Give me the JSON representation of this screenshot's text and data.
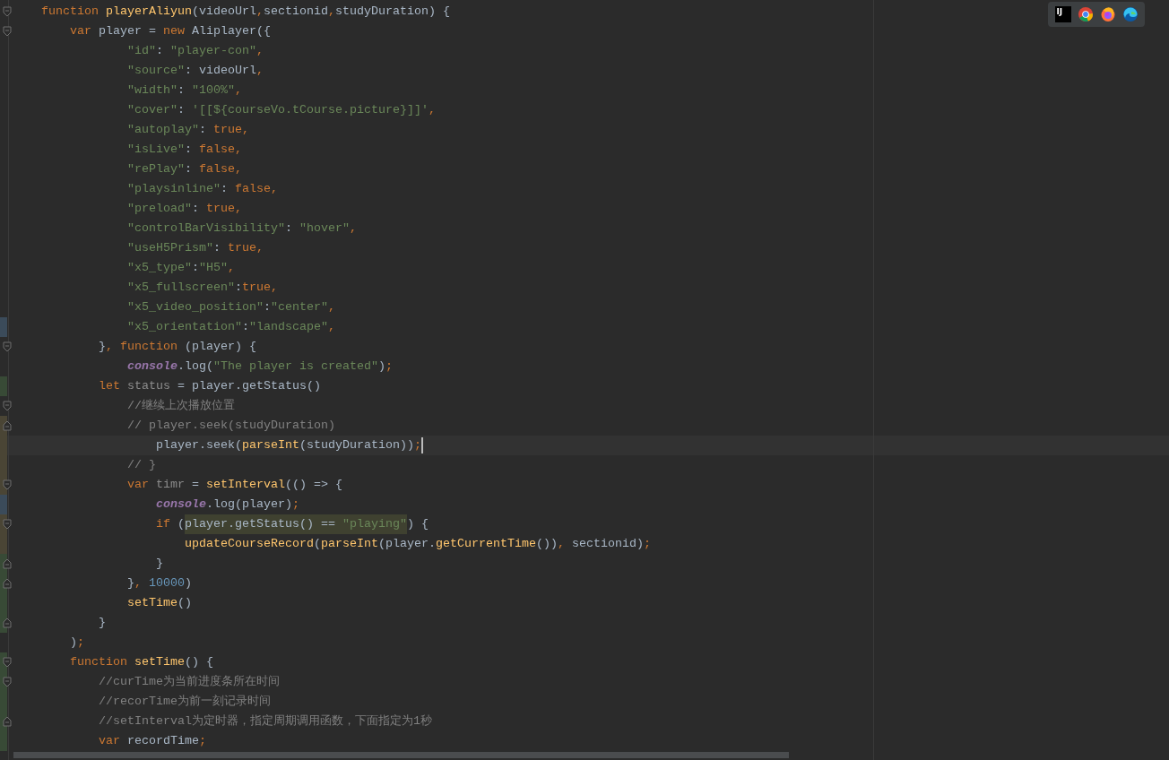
{
  "toolbar": {
    "items": [
      {
        "kind": "ij",
        "label": "IJ"
      },
      {
        "kind": "chrome"
      },
      {
        "kind": "firefox"
      },
      {
        "kind": "edge"
      }
    ]
  },
  "editor": {
    "lines": [
      {
        "caret": false,
        "fold_start": true,
        "tokens": [
          {
            "kind": "kw",
            "text": "function "
          },
          {
            "kind": "fn",
            "text": "playerAliyun"
          },
          {
            "kind": "plain",
            "text": "(videoUrl"
          },
          {
            "kind": "punct",
            "text": ","
          },
          {
            "kind": "plain",
            "text": "sectionid"
          },
          {
            "kind": "punct",
            "text": ","
          },
          {
            "kind": "plain",
            "text": "studyDuration) {"
          }
        ]
      },
      {
        "caret": false,
        "fold_start": true,
        "tokens": [
          {
            "kind": "kw",
            "text": "    var "
          },
          {
            "kind": "plain",
            "text": "player = "
          },
          {
            "kind": "kw",
            "text": "new "
          },
          {
            "kind": "plain",
            "text": "Aliplayer({"
          }
        ]
      },
      {
        "caret": false,
        "tokens": [
          {
            "kind": "str",
            "text": "            \"id\""
          },
          {
            "kind": "plain",
            "text": ": "
          },
          {
            "kind": "str",
            "text": "\"player-con\""
          },
          {
            "kind": "punct",
            "text": ","
          }
        ]
      },
      {
        "caret": false,
        "tokens": [
          {
            "kind": "str",
            "text": "            \"source\""
          },
          {
            "kind": "plain",
            "text": ": videoUrl"
          },
          {
            "kind": "punct",
            "text": ","
          }
        ]
      },
      {
        "caret": false,
        "tokens": [
          {
            "kind": "str",
            "text": "            \"width\""
          },
          {
            "kind": "plain",
            "text": ": "
          },
          {
            "kind": "str",
            "text": "\"100%\""
          },
          {
            "kind": "punct",
            "text": ","
          }
        ]
      },
      {
        "caret": false,
        "tokens": [
          {
            "kind": "str",
            "text": "            \"cover\""
          },
          {
            "kind": "plain",
            "text": ": "
          },
          {
            "kind": "str",
            "text": "'[[${courseVo.tCourse.picture}]]'"
          },
          {
            "kind": "punct",
            "text": ","
          }
        ]
      },
      {
        "caret": false,
        "tokens": [
          {
            "kind": "str",
            "text": "            \"autoplay\""
          },
          {
            "kind": "plain",
            "text": ": "
          },
          {
            "kind": "kw",
            "text": "true,"
          }
        ]
      },
      {
        "caret": false,
        "tokens": [
          {
            "kind": "str",
            "text": "            \"isLive\""
          },
          {
            "kind": "plain",
            "text": ": "
          },
          {
            "kind": "kw",
            "text": "false,"
          }
        ]
      },
      {
        "caret": false,
        "tokens": [
          {
            "kind": "str",
            "text": "            \"rePlay\""
          },
          {
            "kind": "plain",
            "text": ": "
          },
          {
            "kind": "kw",
            "text": "false,"
          }
        ]
      },
      {
        "caret": false,
        "tokens": [
          {
            "kind": "str",
            "text": "            \"playsinline\""
          },
          {
            "kind": "plain",
            "text": ": "
          },
          {
            "kind": "kw",
            "text": "false,"
          }
        ]
      },
      {
        "caret": false,
        "tokens": [
          {
            "kind": "str",
            "text": "            \"preload\""
          },
          {
            "kind": "plain",
            "text": ": "
          },
          {
            "kind": "kw",
            "text": "true,"
          }
        ]
      },
      {
        "caret": false,
        "tokens": [
          {
            "kind": "str",
            "text": "            \"controlBarVisibility\""
          },
          {
            "kind": "plain",
            "text": ": "
          },
          {
            "kind": "str",
            "text": "\"hover\""
          },
          {
            "kind": "punct",
            "text": ","
          }
        ]
      },
      {
        "caret": false,
        "tokens": [
          {
            "kind": "str",
            "text": "            \"useH5Prism\""
          },
          {
            "kind": "plain",
            "text": ": "
          },
          {
            "kind": "kw",
            "text": "true,"
          }
        ]
      },
      {
        "caret": false,
        "tokens": [
          {
            "kind": "str",
            "text": "            \"x5_type\""
          },
          {
            "kind": "plain",
            "text": ":"
          },
          {
            "kind": "str",
            "text": "\"H5\""
          },
          {
            "kind": "punct",
            "text": ","
          }
        ]
      },
      {
        "caret": false,
        "tokens": [
          {
            "kind": "str",
            "text": "            \"x5_fullscreen\""
          },
          {
            "kind": "plain",
            "text": ":"
          },
          {
            "kind": "kw",
            "text": "true,"
          }
        ]
      },
      {
        "caret": false,
        "tokens": [
          {
            "kind": "str",
            "text": "            \"x5_video_position\""
          },
          {
            "kind": "plain",
            "text": ":"
          },
          {
            "kind": "str",
            "text": "\"center\""
          },
          {
            "kind": "punct",
            "text": ","
          }
        ]
      },
      {
        "caret": false,
        "color": "#3b4b5a",
        "tokens": [
          {
            "kind": "str",
            "text": "            \"x5_orientation\""
          },
          {
            "kind": "plain",
            "text": ":"
          },
          {
            "kind": "str",
            "text": "\"landscape\""
          },
          {
            "kind": "punct",
            "text": ","
          }
        ]
      },
      {
        "caret": false,
        "fold_start": true,
        "tokens": [
          {
            "kind": "plain",
            "text": "        }"
          },
          {
            "kind": "punct",
            "text": ", "
          },
          {
            "kind": "kw",
            "text": "function "
          },
          {
            "kind": "plain",
            "text": "(player) {"
          }
        ]
      },
      {
        "caret": false,
        "tokens": [
          {
            "kind": "global",
            "text": "            console"
          },
          {
            "kind": "plain",
            "text": ".log("
          },
          {
            "kind": "str",
            "text": "\"The player is created\""
          },
          {
            "kind": "plain",
            "text": ")"
          },
          {
            "kind": "punct",
            "text": ";"
          }
        ]
      },
      {
        "caret": false,
        "color": "#384a36",
        "tokens": [
          {
            "kind": "kw",
            "text": "        let "
          },
          {
            "kind": "unused",
            "text": "status"
          },
          {
            "kind": "plain",
            "text": " = player.getStatus()"
          }
        ]
      },
      {
        "caret": false,
        "fold_start": true,
        "tokens": [
          {
            "kind": "comment",
            "text": "            //继续上次播放位置"
          }
        ]
      },
      {
        "caret": false,
        "fold_end": true,
        "color": "#4a4535",
        "tokens": [
          {
            "kind": "comment",
            "text": "            // player.seek(studyDuration)"
          }
        ]
      },
      {
        "caret": true,
        "color": "#4a4535",
        "tokens": [
          {
            "kind": "plain",
            "text": "                player.seek("
          },
          {
            "kind": "fn",
            "text": "parseInt"
          },
          {
            "kind": "plain",
            "text": "(studyDuration))"
          },
          {
            "kind": "punct",
            "text": ";"
          }
        ]
      },
      {
        "caret": false,
        "color": "#4a4535",
        "tokens": [
          {
            "kind": "comment",
            "text": "            // }"
          }
        ]
      },
      {
        "caret": false,
        "fold_start": true,
        "color": "#4a4535",
        "tokens": [
          {
            "kind": "kw",
            "text": "            var "
          },
          {
            "kind": "unused",
            "text": "timr"
          },
          {
            "kind": "plain",
            "text": " = "
          },
          {
            "kind": "fn",
            "text": "setInterval"
          },
          {
            "kind": "plain",
            "text": "(() => {"
          }
        ]
      },
      {
        "caret": false,
        "color": "#3b4b5a",
        "tokens": [
          {
            "kind": "global",
            "text": "                console"
          },
          {
            "kind": "plain",
            "text": ".log(player)"
          },
          {
            "kind": "punct",
            "text": ";"
          }
        ]
      },
      {
        "caret": false,
        "fold_start": true,
        "color": "#4a4535",
        "tokens": [
          {
            "kind": "kw",
            "text": "                if "
          },
          {
            "kind": "plain",
            "text": "("
          },
          {
            "kind": "mark",
            "text": "player.getStatus() == "
          },
          {
            "kind": "markstr",
            "text": "\"playing\""
          },
          {
            "kind": "plain",
            "text": ") {"
          }
        ]
      },
      {
        "caret": false,
        "color": "#4a4535",
        "tokens": [
          {
            "kind": "fn",
            "text": "                    updateCourseRecord"
          },
          {
            "kind": "plain",
            "text": "("
          },
          {
            "kind": "fn",
            "text": "parseInt"
          },
          {
            "kind": "plain",
            "text": "(player."
          },
          {
            "kind": "fn",
            "text": "getCurrentTime"
          },
          {
            "kind": "plain",
            "text": "())"
          },
          {
            "kind": "punct",
            "text": ", "
          },
          {
            "kind": "plain",
            "text": "sectionid)"
          },
          {
            "kind": "punct",
            "text": ";"
          }
        ]
      },
      {
        "caret": false,
        "fold_end": true,
        "color": "#384a36",
        "tokens": [
          {
            "kind": "plain",
            "text": "                }"
          }
        ]
      },
      {
        "caret": false,
        "fold_end": true,
        "color": "#384a36",
        "tokens": [
          {
            "kind": "plain",
            "text": "            }"
          },
          {
            "kind": "punct",
            "text": ", "
          },
          {
            "kind": "num",
            "text": "10000"
          },
          {
            "kind": "plain",
            "text": ")"
          }
        ]
      },
      {
        "caret": false,
        "color": "#384a36",
        "tokens": [
          {
            "kind": "fn",
            "text": "            setTime"
          },
          {
            "kind": "plain",
            "text": "()"
          }
        ]
      },
      {
        "caret": false,
        "fold_end": true,
        "color": "#384a36",
        "tokens": [
          {
            "kind": "plain",
            "text": "        }"
          }
        ]
      },
      {
        "caret": false,
        "tokens": [
          {
            "kind": "plain",
            "text": "    )"
          },
          {
            "kind": "punct",
            "text": ";"
          }
        ]
      },
      {
        "caret": false,
        "fold_start": true,
        "color": "#384a36",
        "tokens": [
          {
            "kind": "kw",
            "text": "    function "
          },
          {
            "kind": "fn",
            "text": "setTime"
          },
          {
            "kind": "plain",
            "text": "() {"
          }
        ]
      },
      {
        "caret": false,
        "fold_start": true,
        "color": "#384a36",
        "tokens": [
          {
            "kind": "comment",
            "text": "        //curTime为当前进度条所在时间"
          }
        ]
      },
      {
        "caret": false,
        "color": "#384a36",
        "tokens": [
          {
            "kind": "comment",
            "text": "        //recorTime为前一刻记录时间"
          }
        ]
      },
      {
        "caret": false,
        "fold_end": true,
        "color": "#384a36",
        "tokens": [
          {
            "kind": "comment",
            "text": "        //setInterval为定时器，指定周期调用函数，下面指定为1秒"
          }
        ]
      },
      {
        "caret": false,
        "color": "#384a36",
        "tokens": [
          {
            "kind": "kw",
            "text": "        var "
          },
          {
            "kind": "plain",
            "text": "recordTime"
          },
          {
            "kind": "punct",
            "text": ";"
          }
        ]
      }
    ]
  }
}
